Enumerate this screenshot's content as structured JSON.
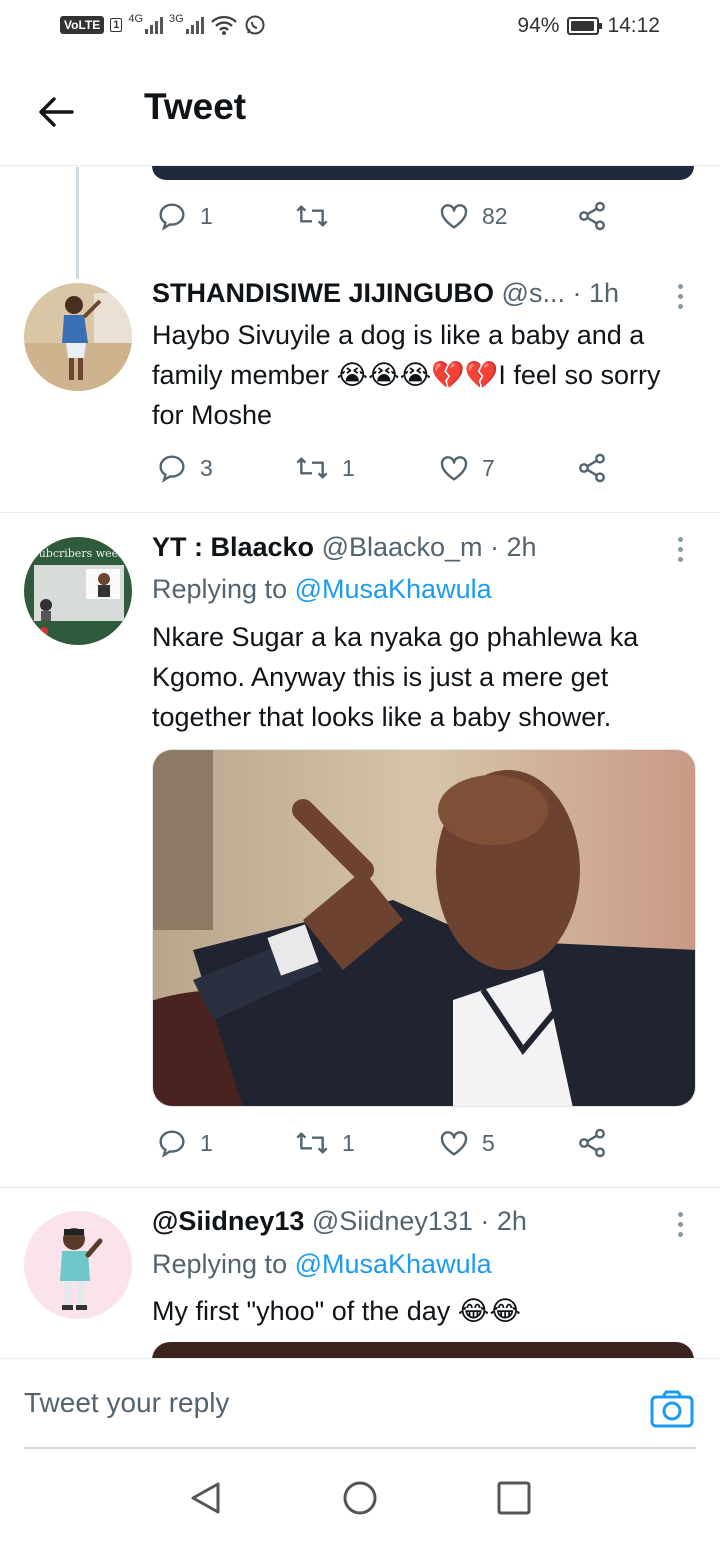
{
  "status_bar": {
    "volte": "VoLTE",
    "sim": "1",
    "net1": "4G",
    "net2": "3G",
    "battery": "94%",
    "battery_level": 0.94,
    "time": "14:12"
  },
  "header": {
    "title": "Tweet"
  },
  "thread_top": {
    "reply_count": "1",
    "retweet_count": "",
    "like_count": "82"
  },
  "tweets": [
    {
      "name": "STHANDISIWE JIJINGUBO",
      "handle_time": " @s...  · 1h",
      "text": "Haybo Sivuyile a dog is like a baby and a family member 😭😭😭💔💔I feel so sorry for Moshe",
      "reply_count": "3",
      "retweet_count": "1",
      "like_count": "7"
    },
    {
      "name": "YT : Blaacko",
      "handle_time": " @Blaacko_m · 2h",
      "replying_label": "Replying to ",
      "replying_to": "@MusaKhawula",
      "avatar_text": "Subcribers week",
      "text": "Nkare Sugar a ka nyaka go phahlewa ka Kgomo. Anyway this is just a mere get together that looks like a baby shower.",
      "reply_count": "1",
      "retweet_count": "1",
      "like_count": "5"
    },
    {
      "name": "@Siidney13",
      "handle_time": " @Siidney131 · 2h",
      "replying_label": "Replying to ",
      "replying_to": "@MusaKhawula",
      "text": "My first \"yhoo\" of the day 😂😂"
    }
  ],
  "reply_bar": {
    "placeholder": "Tweet your reply"
  },
  "colors": {
    "link": "#1d9bf0",
    "muted": "#536471",
    "text": "#0f1419"
  }
}
